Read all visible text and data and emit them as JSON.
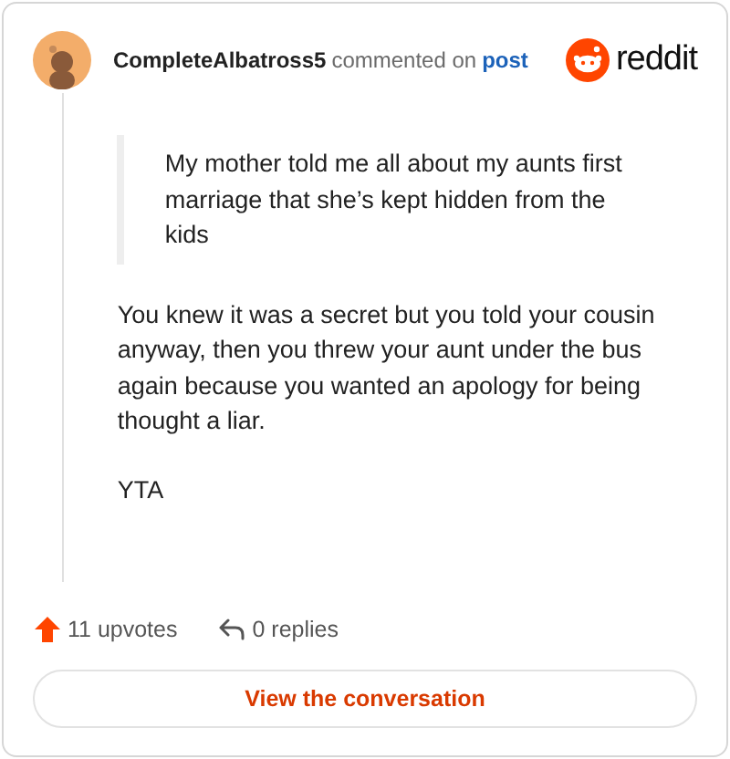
{
  "header": {
    "username": "CompleteAlbatross5",
    "action": "commented on",
    "link": "post",
    "brand": "reddit"
  },
  "quote": "My mother told me all about my aunts first marriage that she’s kept hidden from the kids",
  "paragraphs": [
    "You knew it was a secret but you told your cousin anyway, then you threw your aunt under the bus again because you wanted an apology for being thought a liar.",
    "YTA"
  ],
  "stats": {
    "upvotes": "11 upvotes",
    "replies": "0 replies"
  },
  "button": "View the conversation"
}
